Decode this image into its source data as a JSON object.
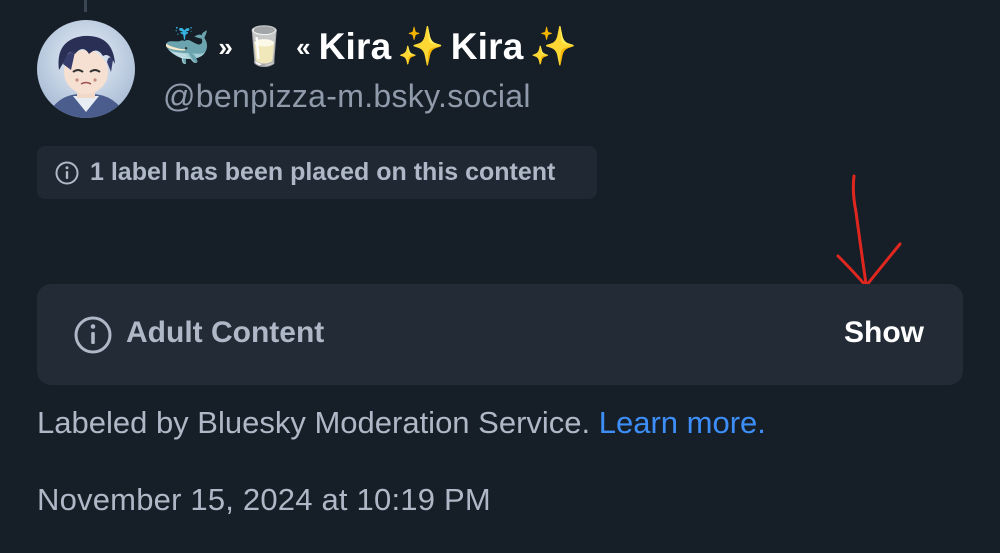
{
  "post": {
    "author": {
      "display_name_prefix_emoji": "🐳",
      "display_name_open": "»",
      "display_name_mid_emoji": "🥛",
      "display_name_close": "«",
      "display_name_word1": "Kira",
      "display_name_sparkle1": "✨",
      "display_name_word2": "Kira",
      "display_name_sparkle2": "✨",
      "handle": "@benpizza-m.bsky.social"
    },
    "label_notice": "1 label has been placed on this content",
    "content_warning": {
      "title": "Adult Content",
      "action_label": "Show"
    },
    "labeled_by": {
      "text": "Labeled by Bluesky Moderation Service. ",
      "link_text": "Learn more."
    },
    "timestamp": "November 15, 2024 at 10:19 PM"
  },
  "colors": {
    "background": "#161e27",
    "card": "#222b36",
    "muted_text": "#aeb8c6",
    "handle_text": "#8f9bab",
    "link": "#3d8ef7",
    "annotation_arrow": "#e0271f"
  },
  "icons": {
    "label_notice_icon": "info-circle-icon",
    "content_warning_icon": "info-circle-icon",
    "annotation": "red-arrow-annotation"
  }
}
